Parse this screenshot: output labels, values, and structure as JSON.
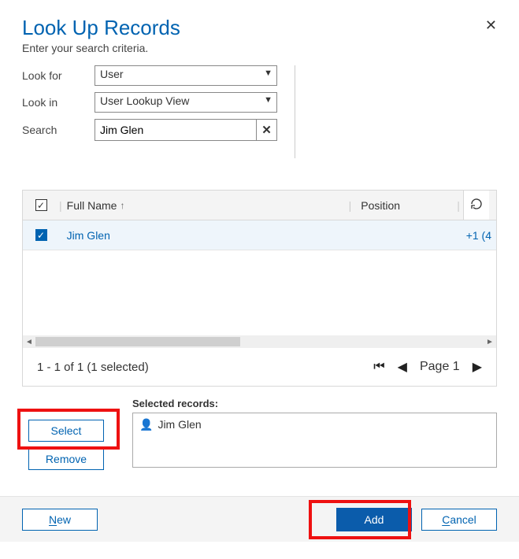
{
  "dialog": {
    "title": "Look Up Records",
    "subtitle": "Enter your search criteria."
  },
  "form": {
    "look_for_label": "Look for",
    "look_for_value": "User",
    "look_in_label": "Look in",
    "look_in_value": "User Lookup View",
    "search_label": "Search",
    "search_value": "Jim Glen"
  },
  "grid": {
    "cols": {
      "fullname": "Full Name",
      "position": "Position"
    },
    "rows": [
      {
        "fullname": "Jim Glen",
        "position": "",
        "extra": "+1 (4"
      }
    ]
  },
  "pager": {
    "info": "1 - 1 of 1 (1 selected)",
    "page_label": "Page 1"
  },
  "selected": {
    "label": "Selected records:",
    "items": [
      "Jim Glen"
    ]
  },
  "buttons": {
    "select": "Select",
    "remove": "Remove",
    "new": "New",
    "add": "Add",
    "cancel": "Cancel"
  }
}
